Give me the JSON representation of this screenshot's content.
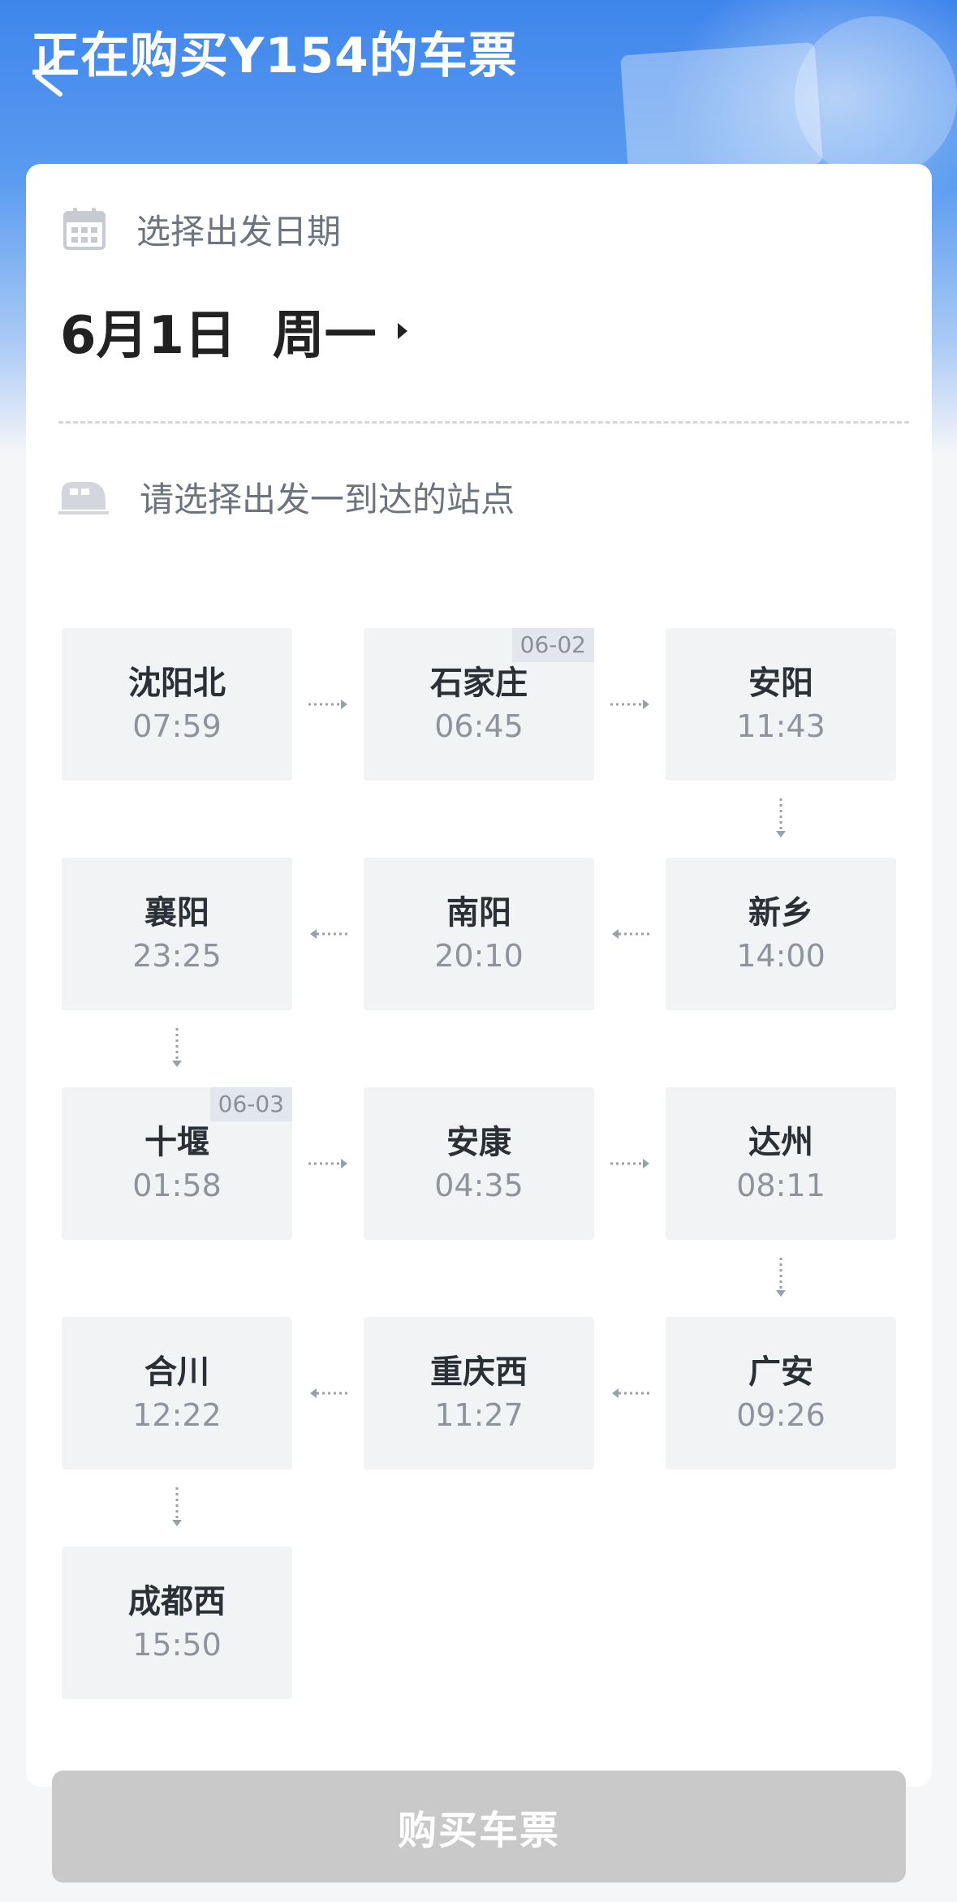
{
  "header": {
    "title": "正在购买Y154的车票"
  },
  "date_section": {
    "label": "选择出发日期",
    "value": "6月1日  周一"
  },
  "station_section": {
    "label": "请选择出发一到达的站点"
  },
  "stops": [
    {
      "name": "沈阳北",
      "time": "07:59"
    },
    {
      "name": "石家庄",
      "time": "06:45",
      "date_tag": "06-02"
    },
    {
      "name": "安阳",
      "time": "11:43"
    },
    {
      "name": "新乡",
      "time": "14:00"
    },
    {
      "name": "南阳",
      "time": "20:10"
    },
    {
      "name": "襄阳",
      "time": "23:25"
    },
    {
      "name": "十堰",
      "time": "01:58",
      "date_tag": "06-03"
    },
    {
      "name": "安康",
      "time": "04:35"
    },
    {
      "name": "达州",
      "time": "08:11"
    },
    {
      "name": "广安",
      "time": "09:26"
    },
    {
      "name": "重庆西",
      "time": "11:27"
    },
    {
      "name": "合川",
      "time": "12:22"
    },
    {
      "name": "成都西",
      "time": "15:50"
    }
  ],
  "buy_button": {
    "label": "购买车票"
  },
  "colors": {
    "accent": "#3f86ec",
    "button_disabled": "#c9c9c9",
    "stop_bg": "#f2f3f5"
  }
}
